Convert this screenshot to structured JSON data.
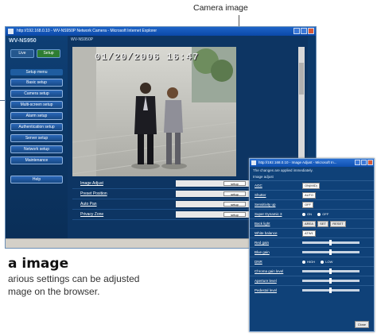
{
  "callout": {
    "label": "Camera image"
  },
  "browser": {
    "title": "http://192.168.0.10 - WV-NS950P Network Camera - Microsoft Internet Explorer",
    "brand": "WV-NS950",
    "content_title": "WV-NS950P",
    "toggle": {
      "live": "Live",
      "setup": "Setup"
    },
    "menu_header": "Setup menu",
    "menu": [
      "Basic setup",
      "Camera setup",
      "Multi-screen setup",
      "Alarm setup",
      "Authentication setup",
      "Server setup",
      "Network setup",
      "Maintenance"
    ],
    "help": "Help",
    "timestamp": "01/20/2006 16:47",
    "settings_rows": [
      {
        "label": "Image Adjust",
        "button": "setup"
      },
      {
        "label": "Preset Position",
        "button": "setup"
      },
      {
        "label": "Auto Pan",
        "button": "setup"
      },
      {
        "label": "Privacy Zone",
        "button": "setup"
      }
    ]
  },
  "heading": "a image",
  "paragraph": [
    "arious settings can be adjusted",
    "mage on the browser."
  ],
  "popup": {
    "title": "http://192.168.0.10 - Image Adjust - Microsoft In...",
    "note": "The changes are applied immediately.",
    "section": "Image adjust",
    "rows": [
      {
        "label": "AGC",
        "type": "select",
        "value": "ON(MID)"
      },
      {
        "label": "Shutter",
        "type": "select",
        "value": "AUTO"
      },
      {
        "label": "Sensitivity up",
        "type": "select",
        "value": "OFF"
      },
      {
        "label": "Super Dynamic 3",
        "type": "radio",
        "options": [
          "ON",
          "OFF"
        ]
      },
      {
        "label": "Back light",
        "type": "buttons",
        "buttons": [
          "AREA",
          "SET",
          "RESET"
        ]
      },
      {
        "label": "White balance",
        "type": "select",
        "value": "ATW1"
      },
      {
        "label": "Red gain",
        "type": "slider",
        "value": 0.5
      },
      {
        "label": "Blue gain",
        "type": "slider",
        "value": 0.5
      },
      {
        "label": "DNR",
        "type": "radio",
        "options": [
          "HIGH",
          "LOW"
        ]
      },
      {
        "label": "Chroma gain level",
        "type": "slider",
        "value": 0.5
      },
      {
        "label": "Aperture level",
        "type": "slider",
        "value": 0.5
      },
      {
        "label": "Pedestal level",
        "type": "slider",
        "value": 0.5
      }
    ],
    "close": "Close"
  },
  "colors": {
    "accent": "#0c3a6b",
    "title_bar": "#1d64c8",
    "status_ok": "#3fa34d"
  }
}
